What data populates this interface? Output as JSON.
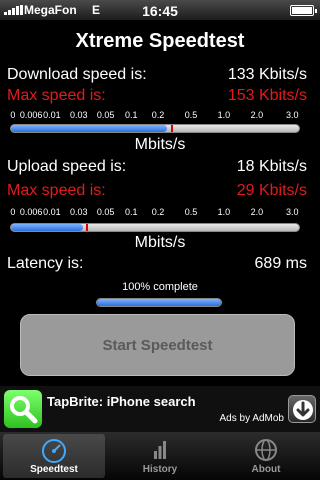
{
  "status_bar": {
    "carrier": "MegaFon",
    "network": "E",
    "time": "16:45",
    "battery_level": 1.0
  },
  "app": {
    "title": "Xtreme Speedtest"
  },
  "download": {
    "label": "Download speed is:",
    "value": "133 Kbits/s",
    "max_label": "Max speed is:",
    "max_value": "153 Kbits/s",
    "fill_fraction": 0.54,
    "max_fraction": 0.555
  },
  "upload": {
    "label": "Upload speed is:",
    "value": "18 Kbits/s",
    "max_label": "Max speed is:",
    "max_value": "29 Kbits/s",
    "fill_fraction": 0.25,
    "max_fraction": 0.26
  },
  "scale_ticks": [
    "0",
    "0.006",
    "0.01",
    "0.03",
    "0.05",
    "0.1",
    "0.2",
    "0.5",
    "1.0",
    "2.0",
    "3.0"
  ],
  "unit": "Mbits/s",
  "latency": {
    "label": "Latency is:",
    "value": "689 ms"
  },
  "progress": {
    "label": "100% complete",
    "fraction": 1.0
  },
  "start_button": {
    "label": "Start Speedtest"
  },
  "ad": {
    "icon": "search-icon",
    "title": "TapBrite: iPhone search",
    "subtitle": "Ads by AdMob",
    "action_icon": "download-icon"
  },
  "tabs": [
    {
      "label": "Speedtest",
      "icon": "speedometer-icon",
      "active": true
    },
    {
      "label": "History",
      "icon": "bar-chart-icon",
      "active": false
    },
    {
      "label": "About",
      "icon": "globe-icon",
      "active": false
    }
  ],
  "colors": {
    "accent_red": "#e21b1b",
    "bar_blue": "#2b6fe0",
    "ad_green": "#2ec21f"
  }
}
